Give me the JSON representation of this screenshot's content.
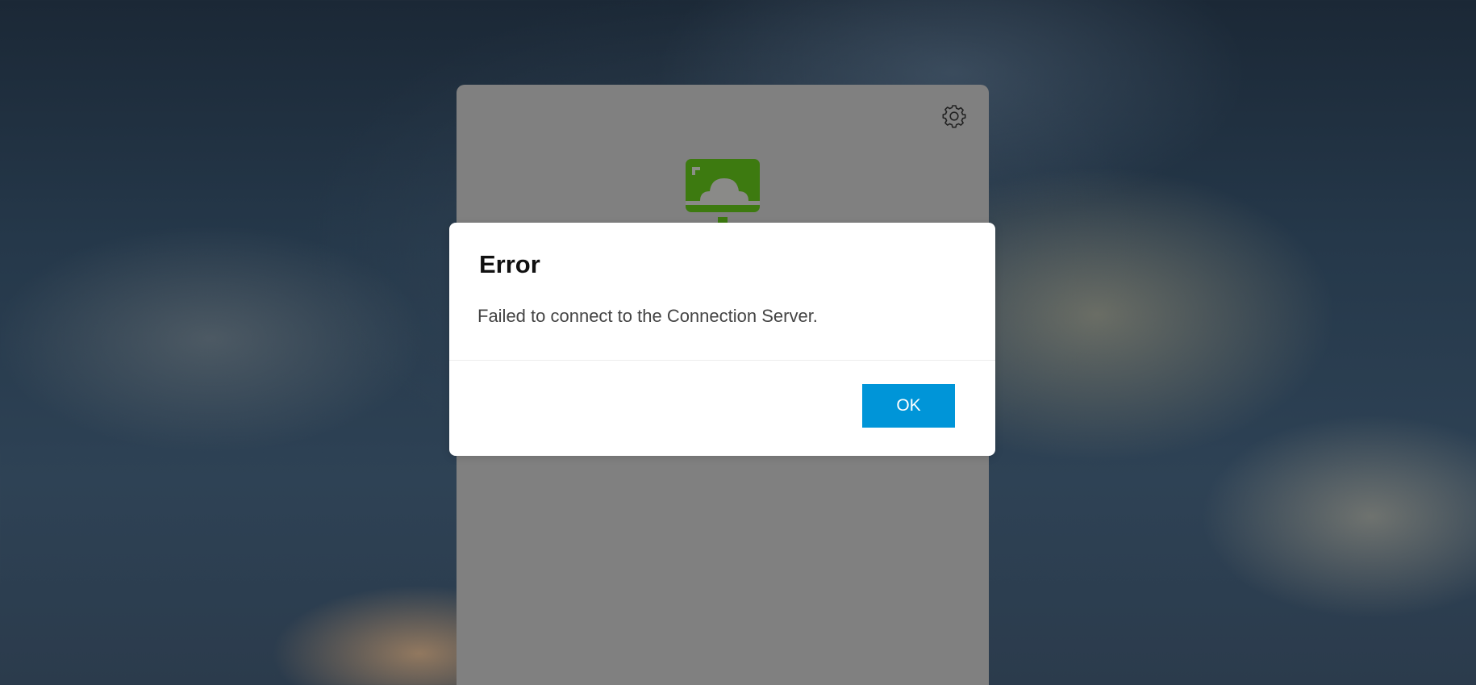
{
  "background": {
    "description_icon": "sky-wallpaper"
  },
  "login_panel": {
    "bg_color": "#808080",
    "settings_icon": "gear-icon",
    "logo_icon": "cloud-desktop-logo-icon",
    "logo_color": "#3d7a10"
  },
  "error_dialog": {
    "title": "Error",
    "message": "Failed to connect to the Connection Server.",
    "ok_label": "OK",
    "ok_color": "#0095d8"
  }
}
